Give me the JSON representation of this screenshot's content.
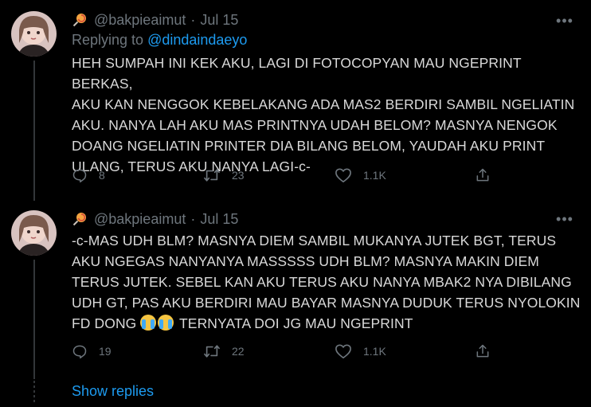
{
  "tweets": [
    {
      "user_handle": "@bakpieaimut",
      "date": "Jul 15",
      "replying_label": "Replying to",
      "replying_handle": "@dindaindaeyo",
      "text": "HEH SUMPAH INI KEK AKU, LAGI DI FOTOCOPYAN MAU NGEPRINT BERKAS,\nAKU KAN NENGGOK KEBELAKANG ADA MAS2 BERDIRI SAMBIL NGELIATIN\nAKU. NANYA LAH AKU MAS PRINTNYA UDAH BELOM? MASNYA NENGOK\nDOANG NGELIATIN PRINTER DIA BILANG BELOM, YAUDAH AKU PRINT\nULANG, TERUS AKU NANYA LAGI-c-",
      "replies": "8",
      "retweets": "23",
      "likes": "1.1K"
    },
    {
      "user_handle": "@bakpieaimut",
      "date": "Jul 15",
      "text_before_emoji": "-c-MAS UDH BLM? MASNYA DIEM SAMBIL MUKANYA JUTEK BGT, TERUS\nAKU NGEGAS NANYANYA MASSSSS UDH BLM? MASNYA MAKIN DIEM\nTERUS JUTEK. SEBEL KAN AKU TERUS AKU NANYA MBAK2 NYA DIBILANG\nUDH GT, PAS AKU BERDIRI MAU BAYAR MASNYA DUDUK TERUS NYOLOKIN\nFD DONG ",
      "text_after_emoji": " TERNYATA DOI JG MAU NGEPRINT",
      "replies": "19",
      "retweets": "22",
      "likes": "1.1K"
    }
  ],
  "show_replies_label": "Show replies",
  "icons": {
    "user_emoji": "lollipop-icon",
    "inline_emoji": "loudly-crying-face-icon",
    "reply": "reply-icon",
    "retweet": "retweet-icon",
    "like": "heart-icon",
    "share": "share-icon",
    "more": "more-icon"
  },
  "colors": {
    "background": "#000000",
    "text": "#d9d9d9",
    "muted": "#6e767d",
    "link": "#1d9bf0"
  }
}
